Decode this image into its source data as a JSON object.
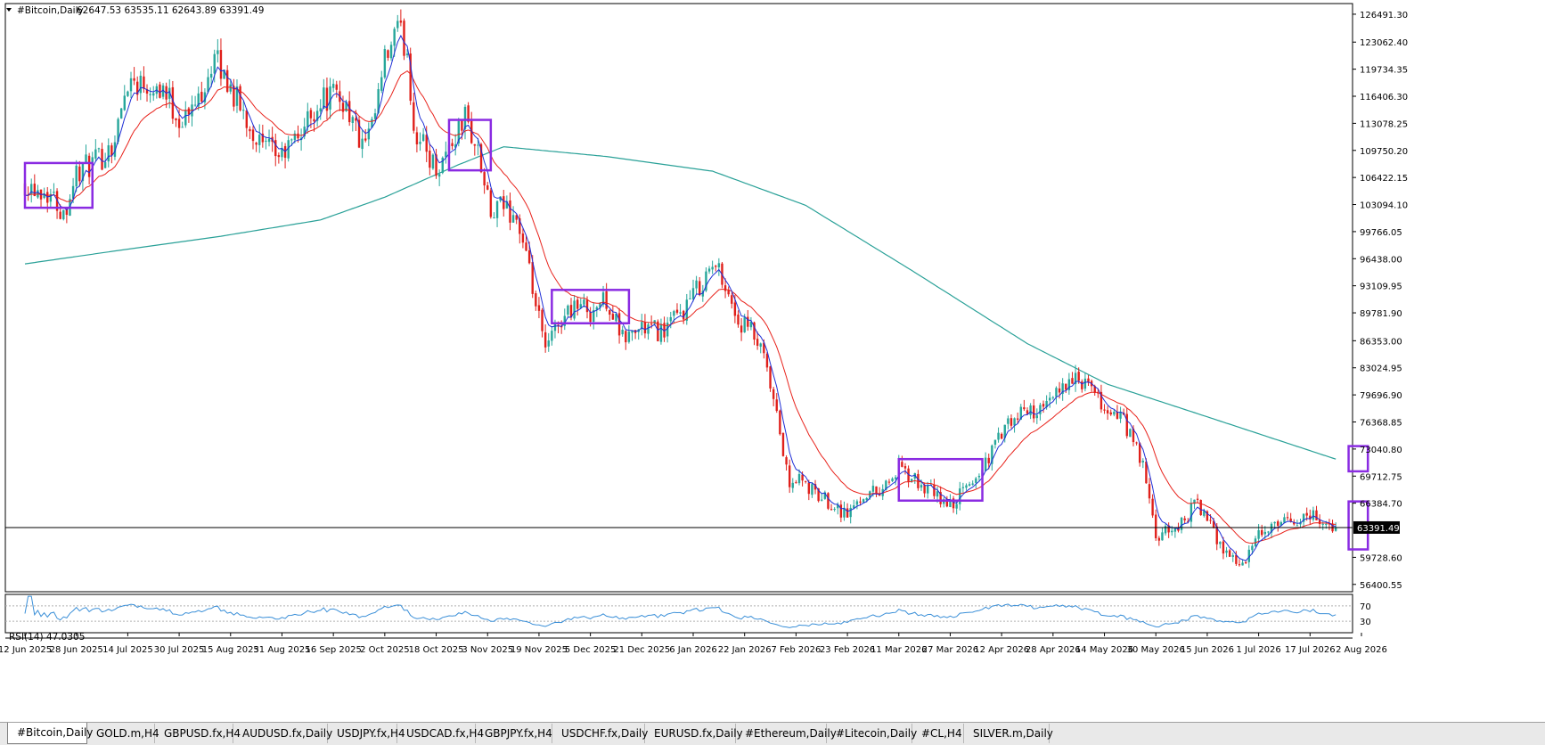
{
  "header": {
    "symbol_label": "#Bitcoin,Daily",
    "ohlc": "62647.53 63535.11 62643.89 63391.49"
  },
  "rsi": {
    "label": "RSI(14) 47.0305",
    "levels": [
      "70",
      "30"
    ]
  },
  "tabs": [
    "#Bitcoin,Daily",
    "GOLD.m,H4",
    "GBPUSD.fx,H4",
    "AUDUSD.fx,Daily",
    "USDJPY.fx,H4",
    "USDCAD.fx,H4",
    "GBPJPY.fx,H4",
    "USDCHF.fx,Daily",
    "EURUSD.fx,Daily",
    "#Ethereum,Daily",
    "#Litecoin,Daily",
    "#CL,H4",
    "SILVER.m,Daily"
  ],
  "active_tab": 0,
  "colors": {
    "bull": "#26a69a",
    "bear": "#e0201b",
    "ma_fast": "#1f2fd6",
    "ma_slow": "#e8231c",
    "ma_long": "#2aa198",
    "box": "#8a2be2",
    "rsi_line": "#3a8fd8",
    "price_line": "#000000"
  },
  "chart_data": {
    "type": "candlestick",
    "title": "#Bitcoin,Daily",
    "current_price": "63391.49",
    "y_ticks": [
      "126491.30",
      "123062.40",
      "119734.35",
      "116406.30",
      "113078.25",
      "109750.20",
      "106422.15",
      "103094.10",
      "99766.05",
      "96438.00",
      "93109.95",
      "89781.90",
      "86353.00",
      "83024.95",
      "79696.90",
      "76368.85",
      "73040.80",
      "69712.75",
      "66384.70",
      "59728.60",
      "56400.55"
    ],
    "ylim": [
      55500,
      127800
    ],
    "x_ticks": [
      "12 Jun 2025",
      "28 Jun 2025",
      "14 Jul 2025",
      "30 Jul 2025",
      "15 Aug 2025",
      "31 Aug 2025",
      "16 Sep 2025",
      "2 Oct 2025",
      "18 Oct 2025",
      "3 Nov 2025",
      "19 Nov 2025",
      "5 Dec 2025",
      "21 Dec 2025",
      "6 Jan 2026",
      "22 Jan 2026",
      "7 Feb 2026",
      "23 Feb 2026",
      "11 Mar 2026",
      "27 Mar 2026",
      "12 Apr 2026",
      "28 Apr 2026",
      "14 May 2026",
      "30 May 2026",
      "15 Jun 2026",
      "1 Jul 2026",
      "17 Jul 2026",
      "2 Aug 2026"
    ],
    "close_path": [
      [
        "12 Jun 2025",
        105800
      ],
      [
        "20 Jun 2025",
        104500
      ],
      [
        "24 Jun 2025",
        102000
      ],
      [
        "28 Jun 2025",
        107000
      ],
      [
        "5 Jul 2025",
        108500
      ],
      [
        "10 Jul 2025",
        111000
      ],
      [
        "14 Jul 2025",
        118500
      ],
      [
        "20 Jul 2025",
        118000
      ],
      [
        "25 Jul 2025",
        117500
      ],
      [
        "30 Jul 2025",
        113500
      ],
      [
        "3 Aug 2025",
        114500
      ],
      [
        "10 Aug 2025",
        121000
      ],
      [
        "15 Aug 2025",
        117500
      ],
      [
        "20 Aug 2025",
        113500
      ],
      [
        "25 Aug 2025",
        110000
      ],
      [
        "31 Aug 2025",
        109000
      ],
      [
        "5 Sep 2025",
        111500
      ],
      [
        "12 Sep 2025",
        116000
      ],
      [
        "16 Sep 2025",
        116500
      ],
      [
        "20 Sep 2025",
        115500
      ],
      [
        "25 Sep 2025",
        110000
      ],
      [
        "28 Sep 2025",
        112000
      ],
      [
        "2 Oct 2025",
        120500
      ],
      [
        "6 Oct 2025",
        124500
      ],
      [
        "9 Oct 2025",
        122000
      ],
      [
        "11 Oct 2025",
        112500
      ],
      [
        "18 Oct 2025",
        107500
      ],
      [
        "24 Oct 2025",
        111500
      ],
      [
        "27 Oct 2025",
        114000
      ],
      [
        "31 Oct 2025",
        109500
      ],
      [
        "4 Nov 2025",
        101500
      ],
      [
        "8 Nov 2025",
        103000
      ],
      [
        "12 Nov 2025",
        101500
      ],
      [
        "16 Nov 2025",
        94500
      ],
      [
        "21 Nov 2025",
        85000
      ],
      [
        "25 Nov 2025",
        88500
      ],
      [
        "30 Nov 2025",
        91000
      ],
      [
        "5 Dec 2025",
        90000
      ],
      [
        "10 Dec 2025",
        91500
      ],
      [
        "15 Dec 2025",
        86500
      ],
      [
        "21 Dec 2025",
        88000
      ],
      [
        "27 Dec 2025",
        87500
      ],
      [
        "2 Jan 2026",
        89500
      ],
      [
        "6 Jan 2026",
        92000
      ],
      [
        "12 Jan 2026",
        95500
      ],
      [
        "15 Jan 2026",
        94500
      ],
      [
        "20 Jan 2026",
        88500
      ],
      [
        "24 Jan 2026",
        87500
      ],
      [
        "28 Jan 2026",
        84000
      ],
      [
        "2 Feb 2026",
        75000
      ],
      [
        "5 Feb 2026",
        68000
      ],
      [
        "7 Feb 2026",
        69500
      ],
      [
        "13 Feb 2026",
        67500
      ],
      [
        "18 Feb 2026",
        66500
      ],
      [
        "23 Feb 2026",
        65000
      ],
      [
        "28 Feb 2026",
        67500
      ],
      [
        "5 Mar 2026",
        68000
      ],
      [
        "11 Mar 2026",
        70500
      ],
      [
        "18 Mar 2026",
        68500
      ],
      [
        "27 Mar 2026",
        66000
      ],
      [
        "5 Apr 2026",
        70000
      ],
      [
        "12 Apr 2026",
        75000
      ],
      [
        "20 Apr 2026",
        78000
      ],
      [
        "25 Apr 2026",
        77500
      ],
      [
        "2 May 2026",
        81500
      ],
      [
        "8 May 2026",
        81000
      ],
      [
        "14 May 2026",
        78000
      ],
      [
        "20 May 2026",
        76500
      ],
      [
        "26 May 2026",
        71000
      ],
      [
        "30 May 2026",
        62000
      ],
      [
        "6 Jun 2026",
        63500
      ],
      [
        "12 Jun 2026",
        66500
      ],
      [
        "18 Jun 2026",
        62000
      ],
      [
        "23 Jun 2026",
        59500
      ],
      [
        "27 Jun 2026",
        59000
      ],
      [
        "1 Jul 2026",
        62500
      ],
      [
        "10 Jul 2026",
        64000
      ],
      [
        "17 Jul 2026",
        65000
      ],
      [
        "25 Jul 2026",
        63391.49
      ]
    ],
    "ma_long_path": [
      [
        "12 Jun 2025",
        95800
      ],
      [
        "12 Jul 2025",
        97500
      ],
      [
        "12 Aug 2025",
        99200
      ],
      [
        "12 Sep 2025",
        101200
      ],
      [
        "2 Oct 2025",
        104000
      ],
      [
        "25 Oct 2025",
        108000
      ],
      [
        "8 Nov 2025",
        110200
      ],
      [
        "10 Dec 2025",
        109000
      ],
      [
        "12 Jan 2026",
        107200
      ],
      [
        "10 Feb 2026",
        103000
      ],
      [
        "15 Mar 2026",
        95000
      ],
      [
        "20 Apr 2026",
        86000
      ],
      [
        "15 May 2026",
        81000
      ],
      [
        "15 Jun 2026",
        77000
      ],
      [
        "25 Jul 2026",
        71800
      ]
    ],
    "boxes": [
      {
        "from": "12 Jun 2025",
        "to": "3 Jul 2025",
        "ylim": [
          102700,
          108200
        ]
      },
      {
        "from": "22 Oct 2025",
        "to": "4 Nov 2025",
        "ylim": [
          107300,
          113500
        ]
      },
      {
        "from": "23 Nov 2025",
        "to": "17 Dec 2025",
        "ylim": [
          88500,
          92600
        ]
      },
      {
        "from": "11 Mar 2026",
        "to": "6 Apr 2026",
        "ylim": [
          66700,
          71800
        ]
      },
      {
        "from": "29 Jul 2026",
        "to": "4 Aug 2026",
        "ylim": [
          70300,
          73400
        ]
      },
      {
        "from": "29 Jul 2026",
        "to": "4 Aug 2026",
        "ylim": [
          60700,
          66600
        ]
      }
    ],
    "rsi": {
      "value": 47.0305,
      "levels": [
        70,
        30
      ],
      "range": [
        0,
        100
      ]
    }
  }
}
